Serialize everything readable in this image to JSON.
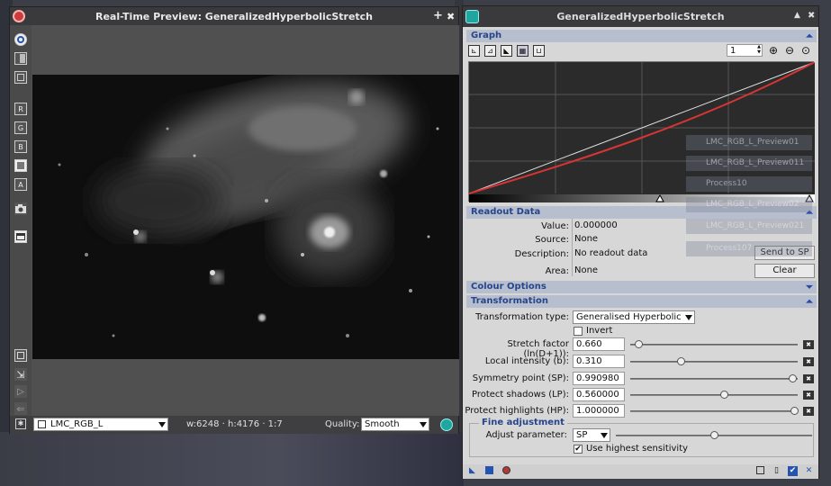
{
  "preview": {
    "title": "Real-Time Preview: GeneralizedHyperbolicStretch",
    "pin_glyph": "+",
    "close_glyph": "✖",
    "tools": [
      "R",
      "G",
      "B",
      "A"
    ],
    "status": {
      "image_select": "LMC_RGB_L",
      "dimensions": "w:6248 · h:4176 · 1:7",
      "quality_label": "Quality:",
      "quality_value": "Smooth"
    }
  },
  "ghs": {
    "title": "GeneralizedHyperbolicStretch",
    "title_glyphs": {
      "shade": "▲",
      "close": "✖"
    },
    "graph": {
      "label": "Graph",
      "zoom_value": "1",
      "stepper_up": "▲",
      "stepper_down": "▼"
    },
    "readout": {
      "label": "Readout Data",
      "value_label": "Value:",
      "value": "0.000000",
      "source_label": "Source:",
      "source": "None",
      "description_label": "Description:",
      "description": "No readout data",
      "area_label": "Area:",
      "area": "None",
      "send_to_sp": "Send to SP",
      "clear": "Clear"
    },
    "colour_options": {
      "label": "Colour Options"
    },
    "transformation": {
      "label": "Transformation",
      "type_label": "Transformation type:",
      "type_value": "Generalised Hyperbolic",
      "invert_label": "Invert",
      "params": [
        {
          "label": "Stretch factor (ln(D+1)):",
          "value": "0.660",
          "fraction": 0.03
        },
        {
          "label": "Local intensity (b):",
          "value": "0.310",
          "fraction": 0.29
        },
        {
          "label": "Symmetry point (SP):",
          "value": "0.990980",
          "fraction": 0.99
        },
        {
          "label": "Protect shadows (LP):",
          "value": "0.560000",
          "fraction": 0.56
        },
        {
          "label": "Protect highlights (HP):",
          "value": "1.000000",
          "fraction": 1.0
        }
      ]
    },
    "fine_adjustment": {
      "label": "Fine adjustment",
      "adjust_label": "Adjust parameter:",
      "adjust_value": "SP",
      "adjust_fraction": 0.5,
      "sensitivity_label": "Use highest sensitivity",
      "sensitivity_checked": true
    }
  },
  "background_ghosts": [
    "LMC_RGB_L_Preview01",
    "LMC_RGB_L_Preview011",
    "Process10",
    "LMC_RGB_L_Preview02",
    "LMC_RGB_L_Preview021",
    "Process107"
  ],
  "colors": {
    "section_bg": "#b7bfce",
    "section_text": "#27458a",
    "curve_red": "#d83434",
    "curve_white": "#e0e0e0"
  }
}
